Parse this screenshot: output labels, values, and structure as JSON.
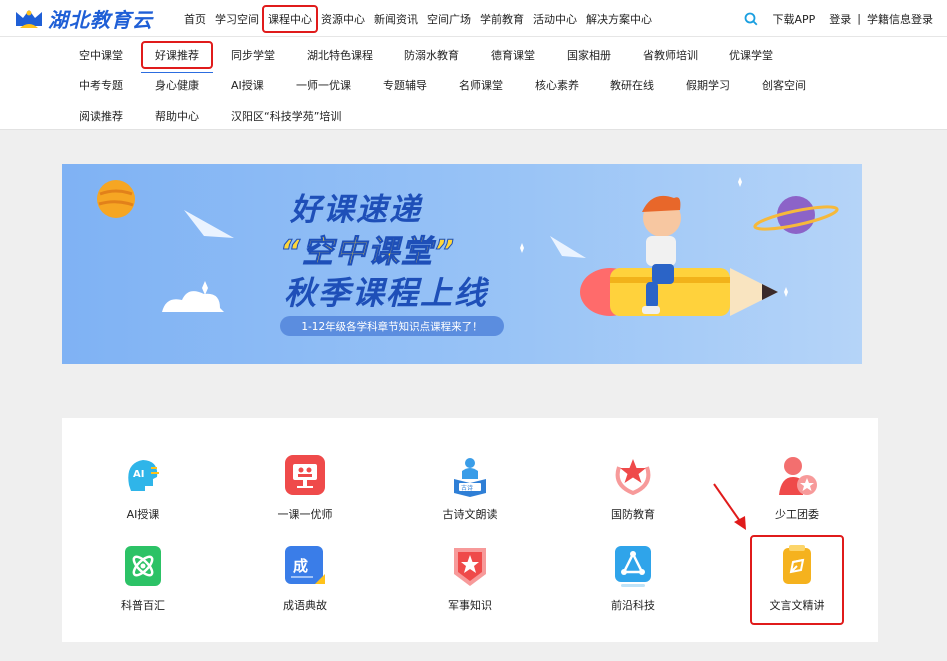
{
  "header": {
    "logo_text": "湖北教育云",
    "nav": [
      "首页",
      "学习空间",
      "课程中心",
      "资源中心",
      "新闻资讯",
      "空间广场",
      "学前教育",
      "活动中心",
      "解决方案中心"
    ],
    "active_nav": "课程中心",
    "download": "下载APP",
    "login": "登录",
    "separator": "|",
    "student_login": "学籍信息登录"
  },
  "subnav": {
    "rows": [
      [
        "空中课堂",
        "好课推荐",
        "同步学堂",
        "湖北特色课程",
        "防溺水教育",
        "德育课堂",
        "国家相册",
        "省教师培训",
        "优课学堂"
      ],
      [
        "中考专题",
        "身心健康",
        "AI授课",
        "一师一优课",
        "专题辅导",
        "名师课堂",
        "核心素养",
        "教研在线",
        "假期学习",
        "创客空间"
      ],
      [
        "阅读推荐",
        "帮助中心",
        "汉阳区“科技学苑”培训"
      ]
    ],
    "active": "好课推荐"
  },
  "banner": {
    "title1": "好课速递",
    "title2": "“空中课堂”",
    "title3": "秋季课程上线",
    "pill": "1-12年级各学科章节知识点课程来了！"
  },
  "courses": {
    "row1": [
      {
        "label": "AI授课",
        "icon": "ai-head-icon",
        "color": "#2fb5e9"
      },
      {
        "label": "一课一优师",
        "icon": "teacher-board-icon",
        "color": "#ef4a4a"
      },
      {
        "label": "古诗文朗读",
        "icon": "poetry-book-icon",
        "color": "#3a9de8"
      },
      {
        "label": "国防教育",
        "icon": "star-emblem-icon",
        "color": "#ef4a4a"
      },
      {
        "label": "少工团委",
        "icon": "youth-league-icon",
        "color": "#ef4a4a"
      }
    ],
    "row2": [
      {
        "label": "科普百汇",
        "icon": "atom-icon",
        "color": "#2cc266"
      },
      {
        "label": "成语典故",
        "icon": "idiom-book-icon",
        "color": "#3a7de8"
      },
      {
        "label": "军事知识",
        "icon": "military-badge-icon",
        "color": "#ef4a4a"
      },
      {
        "label": "前沿科技",
        "icon": "network-triangle-icon",
        "color": "#2fa4ea"
      },
      {
        "label": "文言文精讲",
        "icon": "classical-text-icon",
        "color": "#f5b21e"
      }
    ],
    "highlighted": "文言文精讲"
  }
}
